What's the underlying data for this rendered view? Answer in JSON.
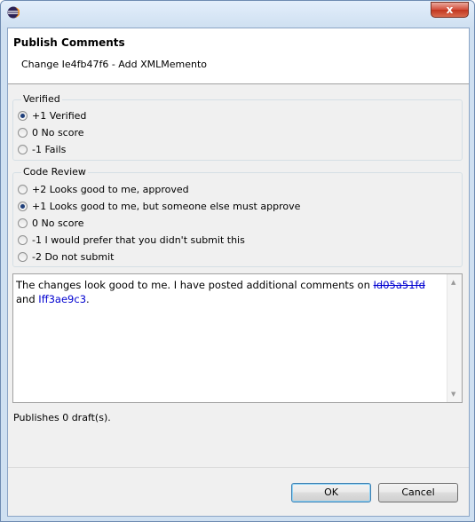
{
  "window": {
    "close_glyph": "x",
    "app_icon": "eclipse-icon"
  },
  "header": {
    "title": "Publish Comments",
    "subtitle": "Change Ie4fb47f6 - Add XMLMemento"
  },
  "verified": {
    "legend": "Verified",
    "options": [
      "+1 Verified",
      "0 No score",
      "-1 Fails"
    ],
    "selected": "+1 Verified"
  },
  "code_review": {
    "legend": "Code Review",
    "options": [
      "+2 Looks good to me, approved",
      "+1 Looks good to me, but someone else must approve",
      "0 No score",
      "-1 I would prefer that you didn't submit this",
      "-2 Do not submit"
    ],
    "selected": "+1 Looks good to me, but someone else must approve"
  },
  "comment": {
    "text_before": "The changes look good to me. I have posted additional comments on ",
    "link1": "Id05a51fd",
    "text_between": " and ",
    "link2": "Iff3ae9c3",
    "text_after": "."
  },
  "status": "Publishes 0 draft(s).",
  "buttons": {
    "ok": "OK",
    "cancel": "Cancel"
  },
  "colors": {
    "link": "#0000d0",
    "close_button": "#c1361f",
    "title_bar": "#cfe0f1"
  }
}
